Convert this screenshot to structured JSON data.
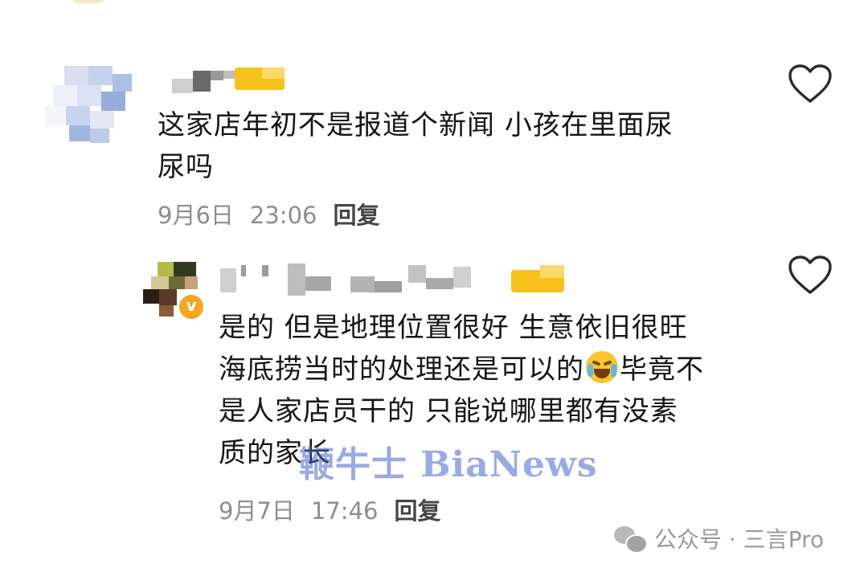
{
  "comments": [
    {
      "text": "这家店年初不是报道个新闻 小孩在里面尿\n尿吗",
      "date": "9月6日",
      "time": "23:06",
      "reply_label": "回复"
    },
    {
      "text_before_emoji": "是的 但是地理位置很好 生意依旧很旺\n海底捞当时的处理还是可以的",
      "emoji": "face-with-tears-of-joy",
      "text_after_emoji": "毕竟不\n是人家店员干的 只能说哪里都有没素\n质的家长",
      "date": "9月7日",
      "time": "17:46",
      "reply_label": "回复"
    }
  ],
  "watermark": "鞭牛士 BiaNews",
  "source": {
    "label": "公众号 · 三言Pro",
    "icon": "wechat-icon"
  },
  "colors": {
    "meta_text": "#8e8e8e",
    "reply": "#444444",
    "watermark": "#4664d2",
    "badge": "#f5b400"
  }
}
